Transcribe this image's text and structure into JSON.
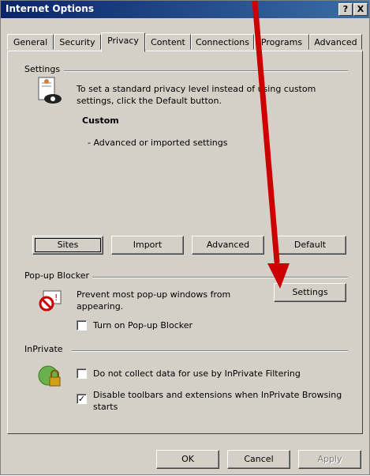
{
  "window": {
    "title": "Internet Options",
    "help_label": "?",
    "close_label": "X"
  },
  "tabs": [
    {
      "label": "General"
    },
    {
      "label": "Security"
    },
    {
      "label": "Privacy"
    },
    {
      "label": "Content"
    },
    {
      "label": "Connections"
    },
    {
      "label": "Programs"
    },
    {
      "label": "Advanced"
    }
  ],
  "active_tab": "Privacy",
  "settings": {
    "group_label": "Settings",
    "description": "To set a standard privacy level instead of using custom settings, click the Default button.",
    "level_name": "Custom",
    "level_detail": "- Advanced or imported settings",
    "buttons": {
      "sites": "Sites",
      "import": "Import",
      "advanced": "Advanced",
      "default": "Default"
    }
  },
  "popup_blocker": {
    "group_label": "Pop-up Blocker",
    "description": "Prevent most pop-up windows from appearing.",
    "settings_button": "Settings",
    "checkbox_label": "Turn on Pop-up Blocker",
    "checked": false
  },
  "inprivate": {
    "group_label": "InPrivate",
    "filtering_label": "Do not collect data for use by InPrivate Filtering",
    "filtering_checked": false,
    "toolbars_label": "Disable toolbars and extensions when InPrivate Browsing starts",
    "toolbars_checked": true,
    "check_mark": "✓"
  },
  "footer": {
    "ok": "OK",
    "cancel": "Cancel",
    "apply": "Apply"
  },
  "annotation": {
    "arrow_color": "#cc0000"
  }
}
